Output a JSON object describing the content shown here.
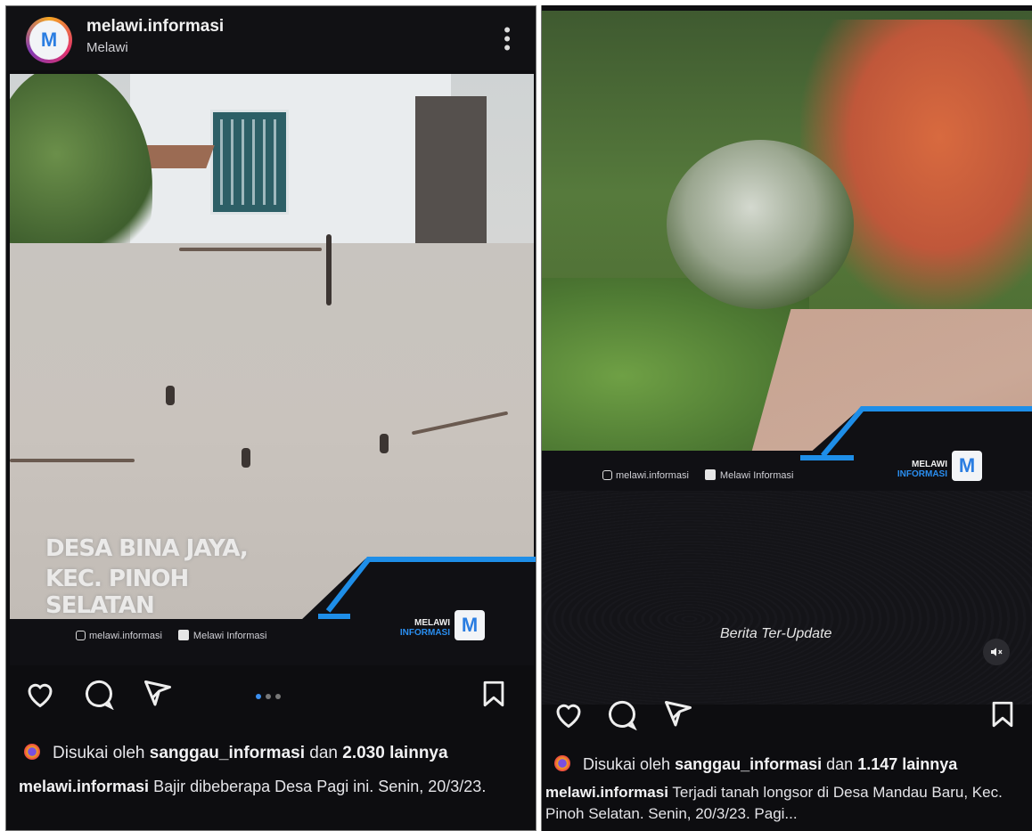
{
  "posts": [
    {
      "username": "melawi.informasi",
      "location": "Melawi",
      "overlay_line1": "DESA BINA JAYA,",
      "overlay_line2": "KEC. PINOH SELATAN",
      "social_ig": "melawi.informasi",
      "social_fb": "Melawi Informasi",
      "brand_top": "MELAWI",
      "brand_bottom": "INFORMASI",
      "likes_prefix": "Disukai oleh",
      "likes_user": "sanggau_informasi",
      "likes_mid": "dan",
      "likes_count": "2.030 lainnya",
      "caption_user": "melawi.informasi",
      "caption_text": "Bajir dibeberapa Desa Pagi ini. Senin, 20/3/23.",
      "carousel_index": 1,
      "carousel_total": 3
    },
    {
      "social_ig": "melawi.informasi",
      "social_fb": "Melawi Informasi",
      "brand_top": "MELAWI",
      "brand_bottom": "INFORMASI",
      "video_label": "Berita Ter-Update",
      "likes_prefix": "Disukai oleh",
      "likes_user": "sanggau_informasi",
      "likes_mid": "dan",
      "likes_count": "1.147 lainnya",
      "caption_user": "melawi.informasi",
      "caption_text": "Terjadi tanah longsor di Desa Mandau Baru, Kec. Pinoh Selatan. Senin, 20/3/23. Pagi..."
    }
  ],
  "icons": {
    "like": "heart-icon",
    "comment": "comment-icon",
    "share": "send-icon",
    "save": "bookmark-icon",
    "more": "more-icon",
    "mute": "mute-icon"
  },
  "colors": {
    "accent_blue": "#1e8ee8",
    "background": "#0d0d10"
  }
}
